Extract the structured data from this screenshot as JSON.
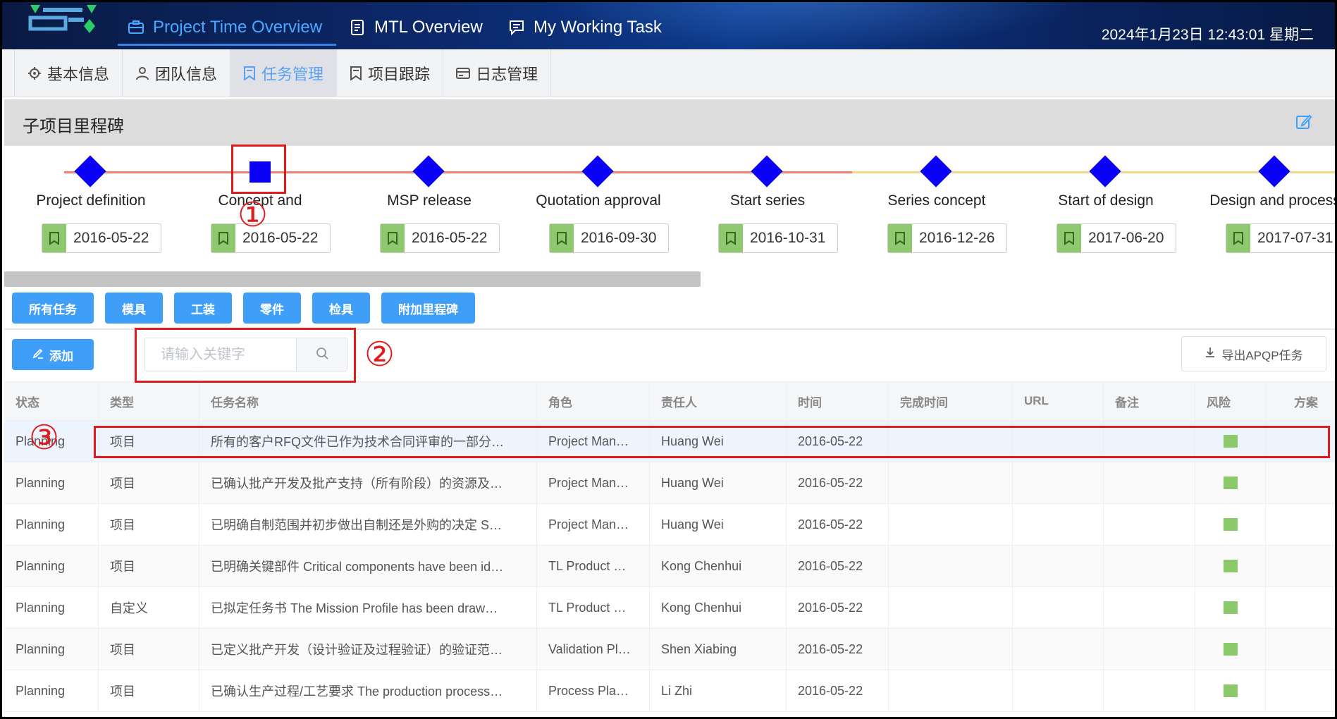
{
  "header": {
    "nav": [
      {
        "label": "Project Time Overview",
        "icon": "briefcase-icon",
        "active": true
      },
      {
        "label": "MTL Overview",
        "icon": "document-icon"
      },
      {
        "label": "My Working Task",
        "icon": "chat-icon"
      }
    ],
    "clock": "2024年1月23日  12:43:01  星期二"
  },
  "tabs": [
    {
      "label": "基本信息",
      "icon": "gear-icon"
    },
    {
      "label": "团队信息",
      "icon": "user-icon"
    },
    {
      "label": "任务管理",
      "icon": "bookmark-icon",
      "active": true
    },
    {
      "label": "项目跟踪",
      "icon": "bookmark-icon"
    },
    {
      "label": "日志管理",
      "icon": "card-icon"
    }
  ],
  "milestone_section": {
    "title": "子项目里程碑",
    "items": [
      {
        "name": "Project definition",
        "date": "2016-05-22",
        "line_color": "#f08070"
      },
      {
        "name": "Concept and",
        "date": "2016-05-22",
        "line_color": "#f08070",
        "selected": true
      },
      {
        "name": "MSP release",
        "date": "2016-05-22",
        "line_color": "#f08070"
      },
      {
        "name": "Quotation approval",
        "date": "2016-09-30",
        "line_color": "#f08070"
      },
      {
        "name": "Start series",
        "date": "2016-10-31",
        "line_color": "#f08070"
      },
      {
        "name": "Series concept",
        "date": "2016-12-26",
        "line_color": "#f5d98a"
      },
      {
        "name": "Start of design",
        "date": "2017-06-20",
        "line_color": "#f5d98a"
      },
      {
        "name": "Design and process",
        "date": "2017-07-31",
        "line_color": "#f5d98a"
      }
    ]
  },
  "filters": [
    "所有任务",
    "模具",
    "工装",
    "零件",
    "检具",
    "附加里程碑"
  ],
  "toolbar": {
    "add_label": "添加",
    "search_placeholder": "请输入关键字",
    "export_label": "导出APQP任务"
  },
  "table": {
    "columns": [
      "状态",
      "类型",
      "任务名称",
      "角色",
      "责任人",
      "时间",
      "完成时间",
      "URL",
      "备注",
      "风险",
      "方案"
    ],
    "rows": [
      {
        "status": "Planning",
        "type": "项目",
        "name": "所有的客户RFQ文件已作为技术合同评审的一部分…",
        "role": "Project Man…",
        "owner": "Huang Wei",
        "time": "2016-05-22",
        "risk": "green"
      },
      {
        "status": "Planning",
        "type": "项目",
        "name": "已确认批产开发及批产支持（所有阶段）的资源及…",
        "role": "Project Man…",
        "owner": "Huang Wei",
        "time": "2016-05-22",
        "risk": "green"
      },
      {
        "status": "Planning",
        "type": "项目",
        "name": "已明确自制范围并初步做出自制还是外购的决定 S…",
        "role": "Project Man…",
        "owner": "Huang Wei",
        "time": "2016-05-22",
        "risk": "green"
      },
      {
        "status": "Planning",
        "type": "项目",
        "name": "已明确关键部件 Critical components have been id…",
        "role": "TL Product …",
        "owner": "Kong Chenhui",
        "time": "2016-05-22",
        "risk": "green"
      },
      {
        "status": "Planning",
        "type": "自定义",
        "name": "已拟定任务书 The Mission Profile has been draw…",
        "role": "TL Product …",
        "owner": "Kong Chenhui",
        "time": "2016-05-22",
        "risk": "green"
      },
      {
        "status": "Planning",
        "type": "项目",
        "name": "已定义批产开发（设计验证及过程验证）的验证范…",
        "role": "Validation Pl…",
        "owner": "Shen Xiabing",
        "time": "2016-05-22",
        "risk": "green"
      },
      {
        "status": "Planning",
        "type": "项目",
        "name": "已确认生产过程/工艺要求 The production process…",
        "role": "Process Pla…",
        "owner": "Li Zhi",
        "time": "2016-05-22",
        "risk": "green"
      }
    ]
  },
  "annotations": [
    "①",
    "②",
    "③"
  ],
  "colors": {
    "accent": "#3f9ef7",
    "milestone": "#0a00f5",
    "risk_ok": "#8bc96b",
    "highlight": "#e01b1b"
  }
}
